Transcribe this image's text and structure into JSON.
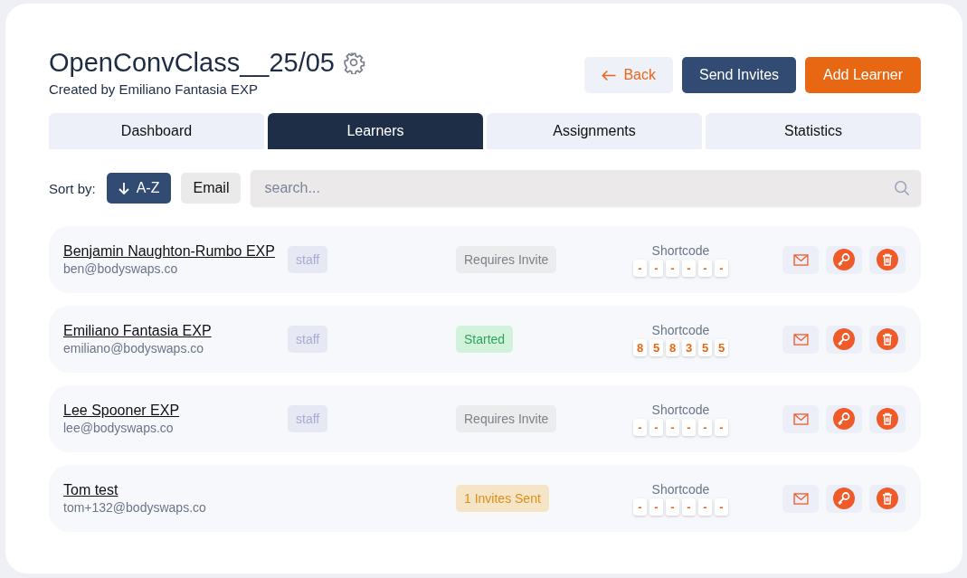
{
  "header": {
    "title": "OpenConvClass__25/05",
    "subtitle": "Created by Emiliano Fantasia EXP"
  },
  "actions": [
    {
      "kind": "back",
      "label": "Back"
    },
    {
      "kind": "primary",
      "label": "Send Invites"
    },
    {
      "kind": "accent",
      "label": "Add Learner"
    }
  ],
  "tabs": [
    {
      "label": "Dashboard",
      "selected": false
    },
    {
      "label": "Learners",
      "selected": true
    },
    {
      "label": "Assignments",
      "selected": false
    },
    {
      "label": "Statistics",
      "selected": false
    }
  ],
  "sort": {
    "label": "Sort by:",
    "options": [
      {
        "label": "A-Z",
        "selected": true
      },
      {
        "label": "Email",
        "selected": false
      }
    ]
  },
  "search": {
    "placeholder": "search..."
  },
  "learners": [
    {
      "name": "Benjamin Naughton-Rumbo EXP",
      "email": "ben@bodyswaps.co",
      "role": "staff",
      "status": {
        "kind": "requires",
        "label": "Requires Invite"
      },
      "shortcode_label": "Shortcode",
      "shortcode": [
        "-",
        "-",
        "-",
        "-",
        "-",
        "-"
      ]
    },
    {
      "name": "Emiliano Fantasia EXP",
      "email": "emiliano@bodyswaps.co",
      "role": "staff",
      "status": {
        "kind": "started",
        "label": "Started"
      },
      "shortcode_label": "Shortcode",
      "shortcode": [
        "8",
        "5",
        "8",
        "3",
        "5",
        "5"
      ]
    },
    {
      "name": "Lee Spooner EXP",
      "email": "lee@bodyswaps.co",
      "role": "staff",
      "status": {
        "kind": "requires",
        "label": "Requires Invite"
      },
      "shortcode_label": "Shortcode",
      "shortcode": [
        "-",
        "-",
        "-",
        "-",
        "-",
        "-"
      ]
    },
    {
      "name": "Tom test",
      "email": "tom+132@bodyswaps.co",
      "status": {
        "kind": "sent",
        "label": "1 Invites Sent"
      },
      "shortcode_label": "Shortcode",
      "shortcode": [
        "-",
        "-",
        "-",
        "-",
        "-",
        "-"
      ]
    }
  ]
}
